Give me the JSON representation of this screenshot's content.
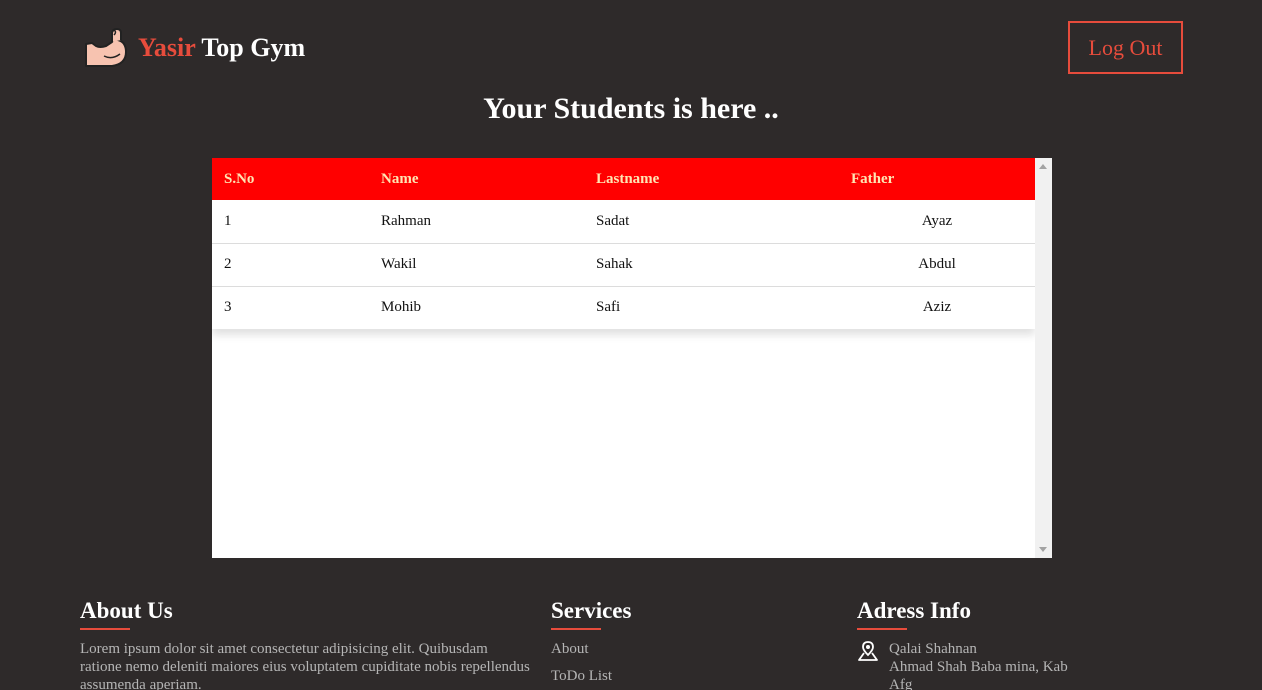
{
  "header": {
    "brand_red": "Yasir",
    "brand_rest": " Top Gym",
    "logout_label": "Log Out"
  },
  "page_title": "Your Students is here ..",
  "table": {
    "columns": [
      "S.No",
      "Name",
      "Lastname",
      "Father"
    ],
    "rows": [
      [
        "1",
        "Rahman",
        "Sadat",
        "Ayaz"
      ],
      [
        "2",
        "Wakil",
        "Sahak",
        "Abdul"
      ],
      [
        "3",
        "Mohib",
        "Safi",
        "Aziz"
      ]
    ]
  },
  "footer": {
    "about": {
      "title": "About Us",
      "text": "Lorem ipsum dolor sit amet consectetur adipisicing elit. Quibusdam ratione nemo deleniti maiores eius voluptatem cupiditate nobis repellendus assumenda aperiam."
    },
    "services": {
      "title": "Services",
      "items": [
        "About",
        "ToDo List"
      ]
    },
    "address": {
      "title": "Adress Info",
      "line1": "Qalai Shahnan",
      "line2": "Ahmad Shah Baba mina, Kab Afg"
    }
  },
  "colors": {
    "accent": "#e74c3c",
    "table_header": "#ff0000",
    "background": "#2e2a2a"
  },
  "icons": {
    "logo": "flexed-bicep-icon",
    "address": "map-pin-icon"
  }
}
